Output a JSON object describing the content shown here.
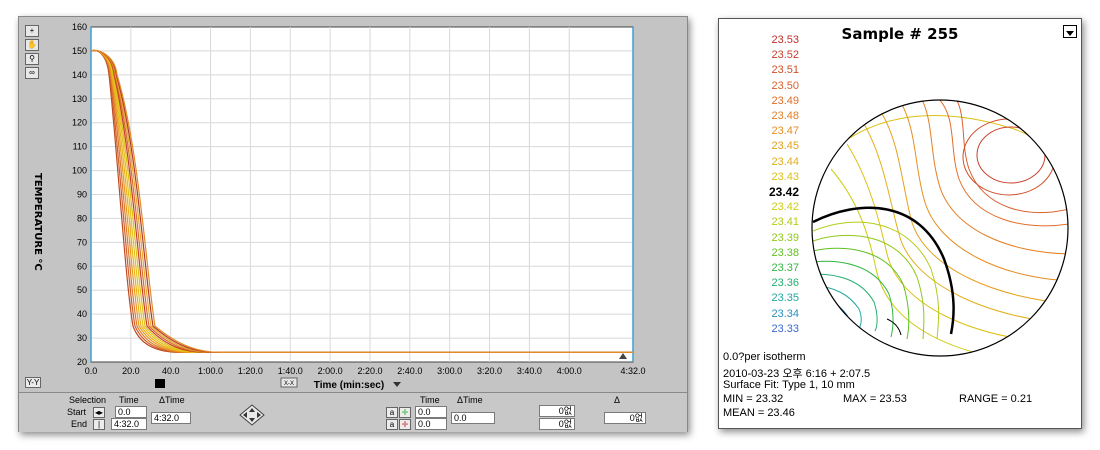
{
  "left_window": {
    "toolbar_icons": [
      "zoom-icon",
      "pan-icon",
      "magnify-icon",
      "binoculars-icon"
    ],
    "y_axis_label": "TEMPERATURE °C",
    "y_ticks": [
      "160",
      "150",
      "140",
      "130",
      "120",
      "110",
      "100",
      "90",
      "80",
      "70",
      "60",
      "50",
      "40",
      "30",
      "20"
    ],
    "x_ticks": [
      "0.0",
      "20.0",
      "40.0",
      "1:00.0",
      "1:20.0",
      "1:40.0",
      "2:00.0",
      "2:20.0",
      "2:40.0",
      "3:00.0",
      "3:20.0",
      "3:40.0",
      "4:00.0",
      "4:32.0"
    ],
    "x_axis_label": "Time (min:sec)",
    "corner_label": "Y-Y",
    "small_button": "X-X",
    "controls": {
      "selection": "Selection",
      "time": "Time",
      "delta_time": "ΔTime",
      "start": "Start",
      "end": "End",
      "start_time": "0.0",
      "end_time": "4:32.0",
      "delta_value": "4:32.0",
      "time2": "Time",
      "delta_time2": "ΔTime",
      "cursor1_time": "0.0",
      "cursor2_time": "0.0",
      "delta_value2": "0.0",
      "delta_sym": "Δ",
      "val1": "0없",
      "val2": "0없",
      "val3": "0없"
    }
  },
  "right_window": {
    "title": "Sample # 255",
    "legend": [
      {
        "value": "23.53",
        "color": "#c0302a"
      },
      {
        "value": "23.52",
        "color": "#c8402c"
      },
      {
        "value": "23.51",
        "color": "#d0502a"
      },
      {
        "value": "23.50",
        "color": "#d8602a"
      },
      {
        "value": "23.49",
        "color": "#e06e28"
      },
      {
        "value": "23.48",
        "color": "#e47e24"
      },
      {
        "value": "23.47",
        "color": "#e68e20"
      },
      {
        "value": "23.45",
        "color": "#e4a01c"
      },
      {
        "value": "23.44",
        "color": "#e2b018"
      },
      {
        "value": "23.43",
        "color": "#dcc012"
      },
      {
        "value": "23.42",
        "color": "#000000",
        "bold": true
      },
      {
        "value": "23.42",
        "color": "#cccc10"
      },
      {
        "value": "23.41",
        "color": "#b4cc14"
      },
      {
        "value": "23.39",
        "color": "#90c818"
      },
      {
        "value": "23.38",
        "color": "#60c020"
      },
      {
        "value": "23.37",
        "color": "#30b840"
      },
      {
        "value": "23.36",
        "color": "#20b070"
      },
      {
        "value": "23.35",
        "color": "#20a8a0"
      },
      {
        "value": "23.34",
        "color": "#2890c0"
      },
      {
        "value": "23.33",
        "color": "#3a68d0"
      }
    ],
    "info": {
      "line1": "0.0?per isotherm",
      "line2": "2010-03-23 오후 6:16 + 2:07.5",
      "line3": "Surface Fit: Type 1, 10 mm",
      "min": "MIN = 23.32",
      "max": "MAX = 23.53",
      "range": "RANGE = 0.21",
      "mean": "MEAN = 23.46"
    }
  }
}
